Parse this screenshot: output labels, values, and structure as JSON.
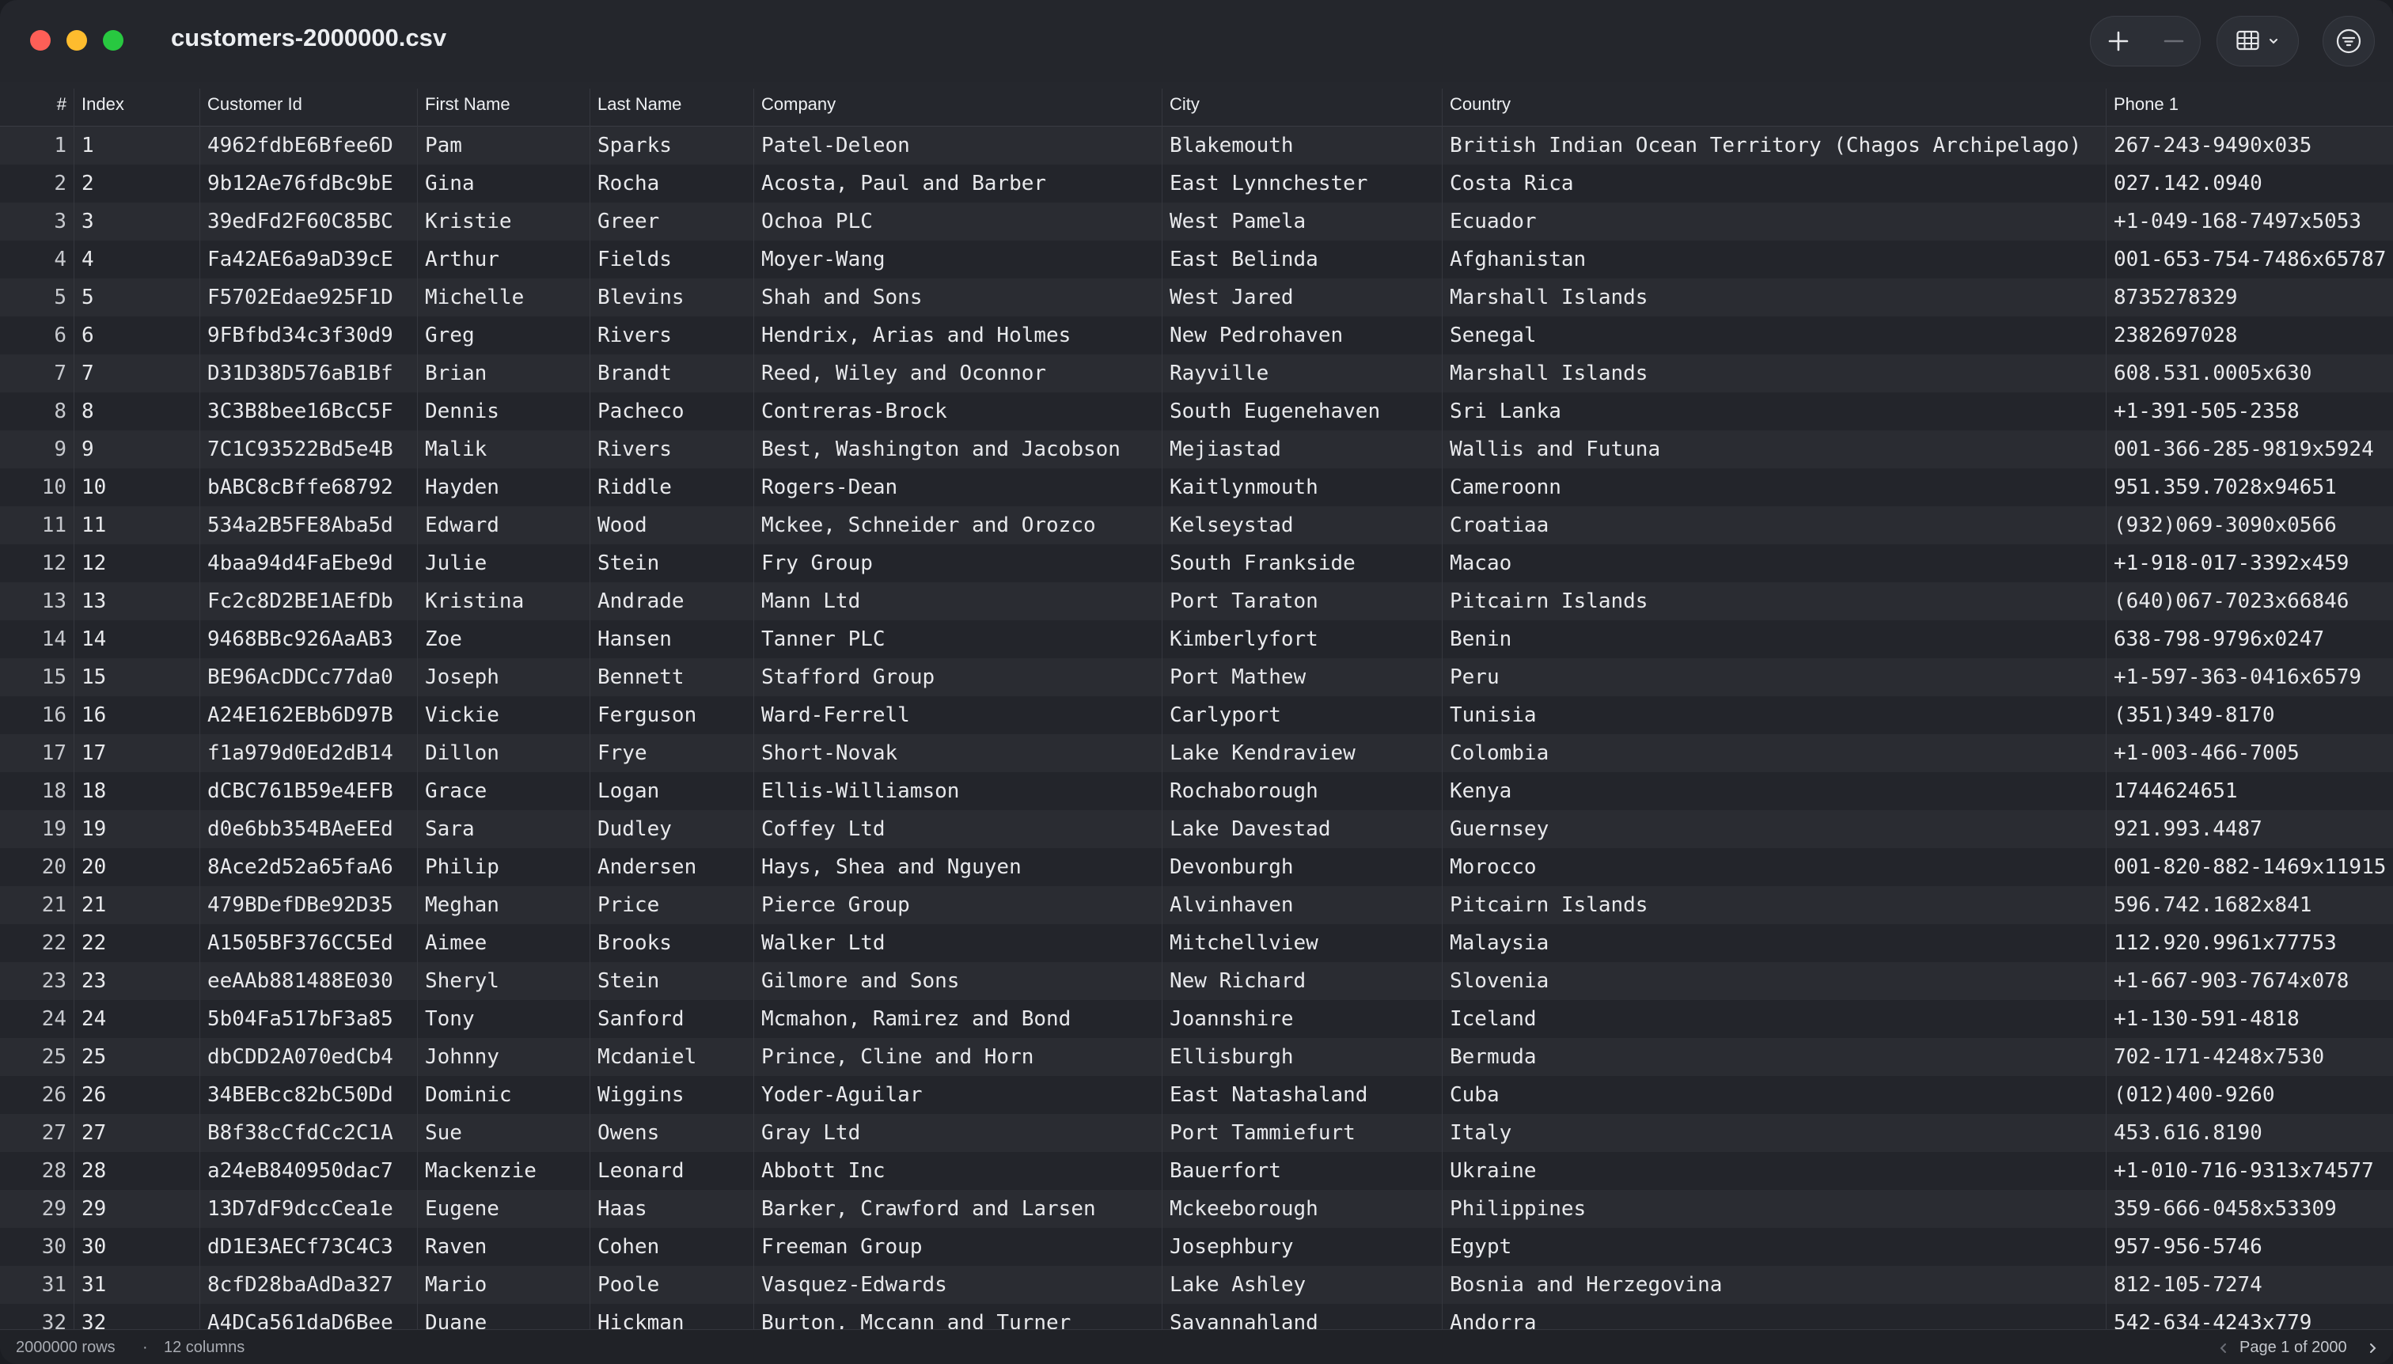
{
  "window": {
    "title": "customers-2000000.csv"
  },
  "toolbar": {
    "add_icon": "plus-icon",
    "remove_icon": "minus-icon",
    "view_icon": "table-icon",
    "filter_icon": "filter-icon"
  },
  "table": {
    "columns": [
      "#",
      "Index",
      "Customer Id",
      "First Name",
      "Last Name",
      "Company",
      "City",
      "Country",
      "Phone 1"
    ],
    "rows": [
      [
        "1",
        "1",
        "4962fdbE6Bfee6D",
        "Pam",
        "Sparks",
        "Patel-Deleon",
        "Blakemouth",
        "British Indian Ocean Territory (Chagos Archipelago)",
        "267-243-9490x035"
      ],
      [
        "2",
        "2",
        "9b12Ae76fdBc9bE",
        "Gina",
        "Rocha",
        "Acosta, Paul and Barber",
        "East Lynnchester",
        "Costa Rica",
        "027.142.0940"
      ],
      [
        "3",
        "3",
        "39edFd2F60C85BC",
        "Kristie",
        "Greer",
        "Ochoa PLC",
        "West Pamela",
        "Ecuador",
        "+1-049-168-7497x5053"
      ],
      [
        "4",
        "4",
        "Fa42AE6a9aD39cE",
        "Arthur",
        "Fields",
        "Moyer-Wang",
        "East Belinda",
        "Afghanistan",
        "001-653-754-7486x65787"
      ],
      [
        "5",
        "5",
        "F5702Edae925F1D",
        "Michelle",
        "Blevins",
        "Shah and Sons",
        "West Jared",
        "Marshall Islands",
        "8735278329"
      ],
      [
        "6",
        "6",
        "9FBfbd34c3f30d9",
        "Greg",
        "Rivers",
        "Hendrix, Arias and Holmes",
        "New Pedrohaven",
        "Senegal",
        "2382697028"
      ],
      [
        "7",
        "7",
        "D31D38D576aB1Bf",
        "Brian",
        "Brandt",
        "Reed, Wiley and Oconnor",
        "Rayville",
        "Marshall Islands",
        "608.531.0005x630"
      ],
      [
        "8",
        "8",
        "3C3B8bee16BcC5F",
        "Dennis",
        "Pacheco",
        "Contreras-Brock",
        "South Eugenehaven",
        "Sri Lanka",
        "+1-391-505-2358"
      ],
      [
        "9",
        "9",
        "7C1C93522Bd5e4B",
        "Malik",
        "Rivers",
        "Best, Washington and Jacobson",
        "Mejiastad",
        "Wallis and Futuna",
        "001-366-285-9819x5924"
      ],
      [
        "10",
        "10",
        "bABC8cBffe68792",
        "Hayden",
        "Riddle",
        "Rogers-Dean",
        "Kaitlynmouth",
        "Cameroonn",
        "951.359.7028x94651"
      ],
      [
        "11",
        "11",
        "534a2B5FE8Aba5d",
        "Edward",
        "Wood",
        "Mckee, Schneider and Orozco",
        "Kelseystad",
        "Croatiaa",
        "(932)069-3090x0566"
      ],
      [
        "12",
        "12",
        "4baa94d4FaEbe9d",
        "Julie",
        "Stein",
        "Fry Group",
        "South Frankside",
        "Macao",
        "+1-918-017-3392x459"
      ],
      [
        "13",
        "13",
        "Fc2c8D2BE1AEfDb",
        "Kristina",
        "Andrade",
        "Mann Ltd",
        "Port Taraton",
        "Pitcairn Islands",
        "(640)067-7023x66846"
      ],
      [
        "14",
        "14",
        "9468BBc926AaAB3",
        "Zoe",
        "Hansen",
        "Tanner PLC",
        "Kimberlyfort",
        "Benin",
        "638-798-9796x0247"
      ],
      [
        "15",
        "15",
        "BE96AcDDCc77da0",
        "Joseph",
        "Bennett",
        "Stafford Group",
        "Port Mathew",
        "Peru",
        "+1-597-363-0416x6579"
      ],
      [
        "16",
        "16",
        "A24E162EBb6D97B",
        "Vickie",
        "Ferguson",
        "Ward-Ferrell",
        "Carlyport",
        "Tunisia",
        "(351)349-8170"
      ],
      [
        "17",
        "17",
        "f1a979d0Ed2dB14",
        "Dillon",
        "Frye",
        "Short-Novak",
        "Lake Kendraview",
        "Colombia",
        "+1-003-466-7005"
      ],
      [
        "18",
        "18",
        "dCBC761B59e4EFB",
        "Grace",
        "Logan",
        "Ellis-Williamson",
        "Rochaborough",
        "Kenya",
        "1744624651"
      ],
      [
        "19",
        "19",
        "d0e6bb354BAeEEd",
        "Sara",
        "Dudley",
        "Coffey Ltd",
        "Lake Davestad",
        "Guernsey",
        "921.993.4487"
      ],
      [
        "20",
        "20",
        "8Ace2d52a65faA6",
        "Philip",
        "Andersen",
        "Hays, Shea and Nguyen",
        "Devonburgh",
        "Morocco",
        "001-820-882-1469x11915"
      ],
      [
        "21",
        "21",
        "479BDefDBe92D35",
        "Meghan",
        "Price",
        "Pierce Group",
        "Alvinhaven",
        "Pitcairn Islands",
        "596.742.1682x841"
      ],
      [
        "22",
        "22",
        "A1505BF376CC5Ed",
        "Aimee",
        "Brooks",
        "Walker Ltd",
        "Mitchellview",
        "Malaysia",
        "112.920.9961x77753"
      ],
      [
        "23",
        "23",
        "eeAAb881488E030",
        "Sheryl",
        "Stein",
        "Gilmore and Sons",
        "New Richard",
        "Slovenia",
        "+1-667-903-7674x078"
      ],
      [
        "24",
        "24",
        "5b04Fa517bF3a85",
        "Tony",
        "Sanford",
        "Mcmahon, Ramirez and Bond",
        "Joannshire",
        "Iceland",
        "+1-130-591-4818"
      ],
      [
        "25",
        "25",
        "dbCDD2A070edCb4",
        "Johnny",
        "Mcdaniel",
        "Prince, Cline and Horn",
        "Ellisburgh",
        "Bermuda",
        "702-171-4248x7530"
      ],
      [
        "26",
        "26",
        "34BEBcc82bC50Dd",
        "Dominic",
        "Wiggins",
        "Yoder-Aguilar",
        "East Natashaland",
        "Cuba",
        "(012)400-9260"
      ],
      [
        "27",
        "27",
        "B8f38cCfdCc2C1A",
        "Sue",
        "Owens",
        "Gray Ltd",
        "Port Tammiefurt",
        "Italy",
        "453.616.8190"
      ],
      [
        "28",
        "28",
        "a24eB840950dac7",
        "Mackenzie",
        "Leonard",
        "Abbott Inc",
        "Bauerfort",
        "Ukraine",
        "+1-010-716-9313x74577"
      ],
      [
        "29",
        "29",
        "13D7dF9dccCea1e",
        "Eugene",
        "Haas",
        "Barker, Crawford and Larsen",
        "Mckeeborough",
        "Philippines",
        "359-666-0458x53309"
      ],
      [
        "30",
        "30",
        "dD1E3AECf73C4C3",
        "Raven",
        "Cohen",
        "Freeman Group",
        "Josephbury",
        "Egypt",
        "957-956-5746"
      ],
      [
        "31",
        "31",
        "8cfD28baAdDa327",
        "Mario",
        "Poole",
        "Vasquez-Edwards",
        "Lake Ashley",
        "Bosnia and Herzegovina",
        "812-105-7274"
      ],
      [
        "32",
        "32",
        "A4DCa561daD6Bee",
        "Duane",
        "Hickman",
        "Burton, Mccann and Turner",
        "Savannahland",
        "Andorra",
        "542-634-4243x779"
      ]
    ]
  },
  "footer": {
    "rows_label": "2000000 rows",
    "sep": "·",
    "cols_label": "12 columns",
    "page_label": "Page 1 of 2000",
    "prev_icon": "chevron-left-icon",
    "next_icon": "chevron-right-icon"
  }
}
